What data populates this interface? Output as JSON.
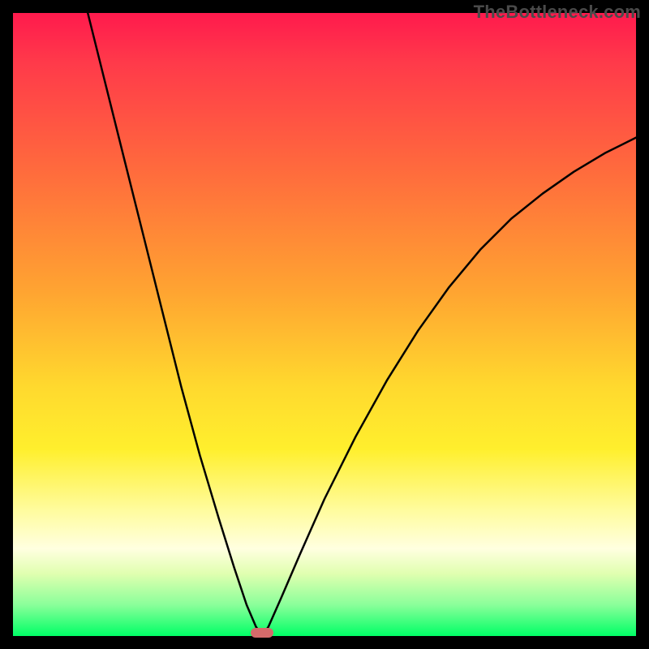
{
  "watermark": "TheBottleneck.com",
  "chart_data": {
    "type": "line",
    "title": "",
    "xlabel": "",
    "ylabel": "",
    "xlim": [
      0,
      1
    ],
    "ylim": [
      0,
      1
    ],
    "grid": false,
    "note": "Axes are unlabeled. x and y are normalized plot coordinates (0=left/bottom, 1=right/top). Curve is a V-shape with minimum near x≈0.40 at y≈0. Left branch rises steeply to y≈1 at x≈0.12; right branch rises more gently reaching y≈0.79 at x=1.",
    "series": [
      {
        "name": "curve",
        "x": [
          0.12,
          0.15,
          0.18,
          0.21,
          0.24,
          0.27,
          0.3,
          0.33,
          0.355,
          0.375,
          0.39,
          0.4,
          0.41,
          0.43,
          0.46,
          0.5,
          0.55,
          0.6,
          0.65,
          0.7,
          0.75,
          0.8,
          0.85,
          0.9,
          0.95,
          1.0
        ],
        "y": [
          1.0,
          0.88,
          0.76,
          0.64,
          0.52,
          0.4,
          0.29,
          0.19,
          0.11,
          0.05,
          0.015,
          0.0,
          0.015,
          0.06,
          0.13,
          0.22,
          0.32,
          0.41,
          0.49,
          0.56,
          0.62,
          0.67,
          0.71,
          0.745,
          0.775,
          0.8
        ]
      }
    ],
    "marker": {
      "x": 0.4,
      "y": 0.0,
      "shape": "pill",
      "color": "#d46a6a"
    },
    "background_gradient": {
      "stops": [
        {
          "pos": 0.0,
          "color": "#ff1a4d"
        },
        {
          "pos": 0.25,
          "color": "#ff6a3d"
        },
        {
          "pos": 0.6,
          "color": "#ffd92e"
        },
        {
          "pos": 0.86,
          "color": "#ffffe0"
        },
        {
          "pos": 1.0,
          "color": "#00ff66"
        }
      ]
    }
  }
}
